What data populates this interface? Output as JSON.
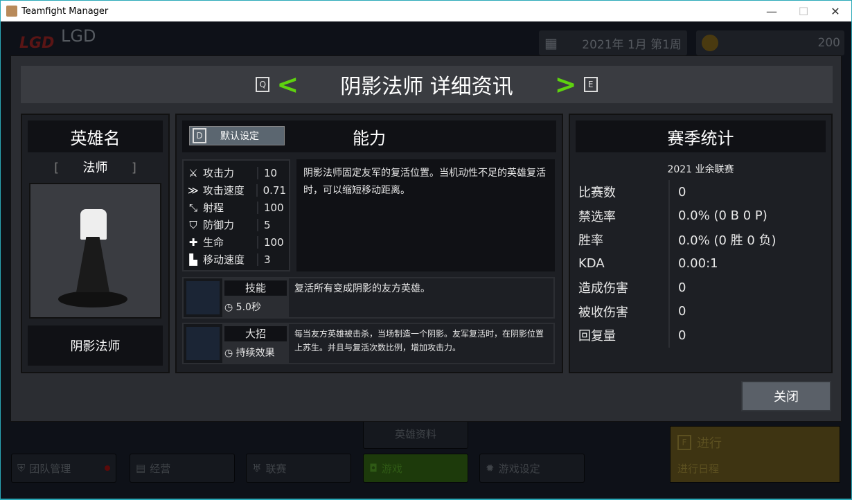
{
  "window": {
    "title": "Teamfight Manager",
    "minimize": "—",
    "maximize": "☐",
    "close": "✕"
  },
  "background": {
    "team_name": "LGD",
    "logo_text": "LGD",
    "date": "2021年 1月 第1周",
    "money": "200",
    "hero_data_button": "英雄资料",
    "nav": [
      {
        "label": "团队管理",
        "icon": "shield-icon"
      },
      {
        "label": "经营",
        "icon": "document-icon"
      },
      {
        "label": "联赛",
        "icon": "trophy-icon"
      },
      {
        "label": "游戏",
        "icon": "gamepad-icon"
      },
      {
        "label": "游戏设定",
        "icon": "gear-icon"
      }
    ],
    "proceed": {
      "key": "F",
      "title": "进行",
      "subtitle": "进行日程"
    }
  },
  "modal": {
    "prev_key": "Q",
    "next_key": "E",
    "title": "阴影法师 详细资讯",
    "hero": {
      "header": "英雄名",
      "class": "法师",
      "name": "阴影法师"
    },
    "ability": {
      "header": "能力",
      "default_key": "D",
      "default_label": "默认设定",
      "stats": [
        {
          "label": "攻击力",
          "value": "10",
          "icon": "sword-icon"
        },
        {
          "label": "攻击速度",
          "value": "0.71",
          "icon": "attack-speed-icon"
        },
        {
          "label": "射程",
          "value": "100",
          "icon": "range-icon"
        },
        {
          "label": "防御力",
          "value": "5",
          "icon": "shield-icon"
        },
        {
          "label": "生命",
          "value": "100",
          "icon": "health-cross-icon"
        },
        {
          "label": "移动速度",
          "value": "3",
          "icon": "boot-icon"
        }
      ],
      "description": "阴影法师固定友军的复活位置。当机动性不足的英雄复活时，可以缩短移动距离。",
      "skill": {
        "label": "技能",
        "cooldown": "5.0秒",
        "description": "复活所有变成阴影的友方英雄。"
      },
      "ultimate": {
        "label": "大招",
        "cooldown": "持续效果",
        "description": "每当友方英雄被击杀，当场制造一个阴影。友军复活时，在阴影位置上苏生。并且与复活次数比例，增加攻击力。"
      }
    },
    "season": {
      "header": "赛季统计",
      "league": "2021 业余联赛",
      "rows": [
        {
          "label": "比赛数",
          "value": "0"
        },
        {
          "label": "禁选率",
          "value": "0.0% (0 B 0 P)"
        },
        {
          "label": "胜率",
          "value": "0.0% (0 胜 0 负)"
        },
        {
          "label": "KDA",
          "value": "0.00:1"
        },
        {
          "label": "造成伤害",
          "value": "0"
        },
        {
          "label": "被收伤害",
          "value": "0"
        },
        {
          "label": "回复量",
          "value": "0"
        }
      ]
    },
    "close_label": "关闭"
  },
  "colors": {
    "accent_green": "#5ed20f",
    "proceed": "#3e3412"
  }
}
